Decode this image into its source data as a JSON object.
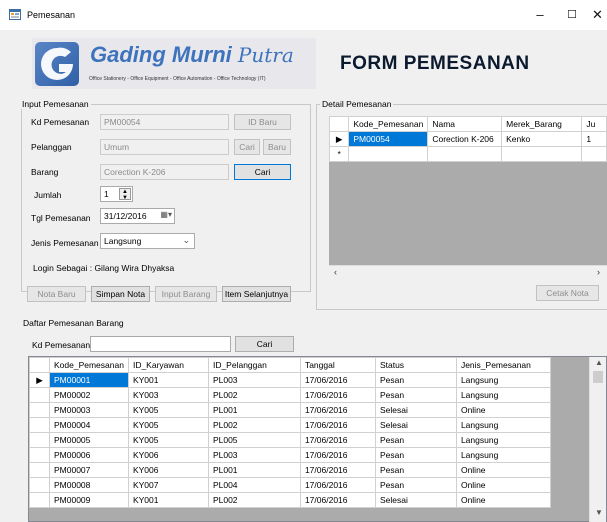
{
  "window": {
    "title": "Pemesanan"
  },
  "logo": {
    "name_bold": "Gading Murni ",
    "name_script": "Putra",
    "tagline": "Office Stationery - Office Equipment - Office Automation - Office Technology (IT)"
  },
  "form_title": "FORM PEMESANAN",
  "input": {
    "legend": "Input Pemesanan",
    "kd_label": "Kd Pemesanan",
    "kd_value": "PM00054",
    "id_baru": "ID Baru",
    "pelanggan_label": "Pelanggan",
    "pelanggan_value": "Umum",
    "cari": "Cari",
    "baru": "Baru",
    "barang_label": "Barang",
    "barang_value": "Corection K-206",
    "barang_cari": "Cari",
    "jumlah_label": "Jumlah",
    "jumlah_value": "1",
    "tgl_label": "Tgl Pemesanan",
    "tgl_value": "31/12/2016",
    "jenis_label": "Jenis Pemesanan",
    "jenis_value": "Langsung",
    "login_text": "Login Sebagai : Gilang Wira Dhyaksa",
    "btn_nota_baru": "Nota Baru",
    "btn_simpan": "Simpan Nota",
    "btn_input_barang": "Input Barang",
    "btn_item_selanjutnya": "Item Selanjutnya"
  },
  "detail": {
    "legend": "Detail Pemesanan",
    "columns": [
      "Kode_Pemesanan",
      "Nama",
      "Merek_Barang",
      "Ju"
    ],
    "row": [
      "PM00054",
      "Corection K-206",
      "Kenko",
      "1"
    ],
    "row_marker": "▶",
    "new_marker": "*",
    "btn_cetak": "Cetak Nota"
  },
  "daftar": {
    "legend": "Daftar Pemesanan Barang",
    "kd_label": "Kd Pemesanan",
    "kd_value": "",
    "cari": "Cari",
    "columns": [
      "Kode_Pemesanan",
      "ID_Karyawan",
      "ID_Pelanggan",
      "Tanggal",
      "Status",
      "Jenis_Pemesanan"
    ],
    "rows": [
      [
        "PM00001",
        "KY001",
        "PL003",
        "17/06/2016",
        "Pesan",
        "Langsung"
      ],
      [
        "PM00002",
        "KY003",
        "PL002",
        "17/06/2016",
        "Pesan",
        "Langsung"
      ],
      [
        "PM00003",
        "KY005",
        "PL001",
        "17/06/2016",
        "Selesai",
        "Online"
      ],
      [
        "PM00004",
        "KY005",
        "PL002",
        "17/06/2016",
        "Selesai",
        "Langsung"
      ],
      [
        "PM00005",
        "KY005",
        "PL005",
        "17/06/2016",
        "Pesan",
        "Langsung"
      ],
      [
        "PM00006",
        "KY006",
        "PL003",
        "17/06/2016",
        "Pesan",
        "Langsung"
      ],
      [
        "PM00007",
        "KY006",
        "PL001",
        "17/06/2016",
        "Pesan",
        "Online"
      ],
      [
        "PM00008",
        "KY007",
        "PL004",
        "17/06/2016",
        "Pesan",
        "Online"
      ],
      [
        "PM00009",
        "KY001",
        "PL002",
        "17/06/2016",
        "Selesai",
        "Online"
      ]
    ]
  }
}
